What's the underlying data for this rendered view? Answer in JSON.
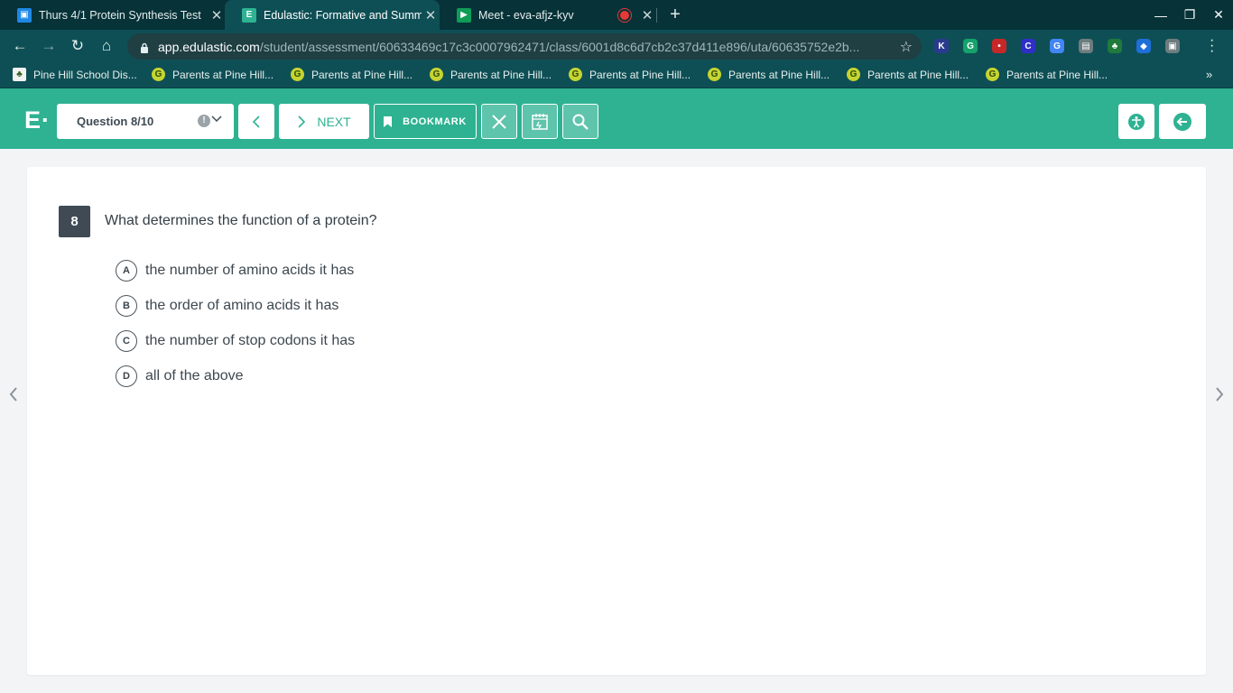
{
  "browser": {
    "tabs": [
      {
        "title": "Thurs 4/1 Protein Synthesis Test",
        "favicon": "classroom-icon"
      },
      {
        "title": "Edulastic: Formative and Summ",
        "favicon": "edulastic-icon"
      },
      {
        "title": "Meet - eva-afjz-kyv",
        "favicon": "meet-icon"
      }
    ],
    "url_host": "app.edulastic.com",
    "url_path": "/student/assessment/60633469c17c3c0007962471/class/6001d8c6d7cb2c37d411e896/uta/60635752e2b...",
    "extensions": [
      {
        "letter": "K",
        "color": "#2b3a8f"
      },
      {
        "letter": "G",
        "color": "#15a26b"
      },
      {
        "letter": "•",
        "color": "#c62828"
      },
      {
        "letter": "C",
        "color": "#2f2fc8"
      },
      {
        "letter": "G",
        "color": "#4285f4"
      },
      {
        "letter": "▤",
        "color": "#6d7c7e"
      },
      {
        "letter": "♣",
        "color": "#1f7a3b"
      },
      {
        "letter": "◆",
        "color": "#1e6fd8"
      },
      {
        "letter": "▣",
        "color": "#6d7c7e"
      }
    ],
    "bookmarks": [
      "Pine Hill School Dis...",
      "Parents at Pine Hill...",
      "Parents at Pine Hill...",
      "Parents at Pine Hill...",
      "Parents at Pine Hill...",
      "Parents at Pine Hill...",
      "Parents at Pine Hill...",
      "Parents at Pine Hill..."
    ]
  },
  "header": {
    "logo": "E·",
    "question_selector": "Question 8/10",
    "next_label": "NEXT",
    "bookmark_label": "BOOKMARK",
    "accent_color": "#2eb292"
  },
  "question": {
    "number": "8",
    "text": "What determines the function of a protein?",
    "options": [
      {
        "letter": "A",
        "text": "the number of amino acids it has"
      },
      {
        "letter": "B",
        "text": "the order of amino acids it has"
      },
      {
        "letter": "C",
        "text": "the number of stop codons it has"
      },
      {
        "letter": "D",
        "text": "all of the above"
      }
    ]
  }
}
